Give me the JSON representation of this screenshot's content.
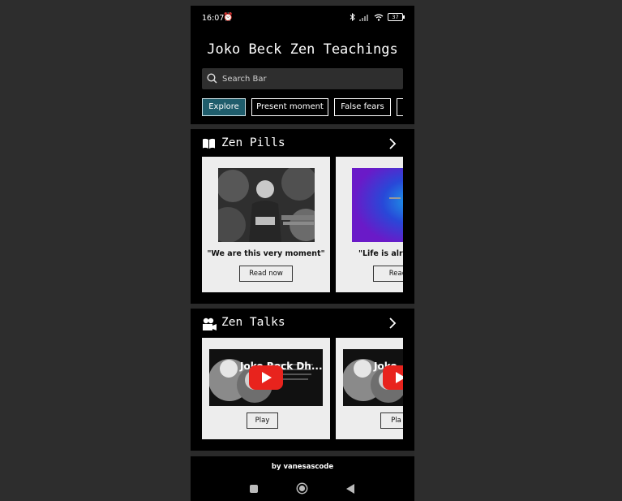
{
  "status_bar": {
    "time": "16:07",
    "battery": "37",
    "icons": [
      "alarm-icon",
      "bluetooth-icon",
      "signal-icon",
      "wifi-icon",
      "battery-icon"
    ]
  },
  "header": {
    "title": "Joko Beck Zen Teachings",
    "search_placeholder": "Search Bar",
    "chips": [
      "Explore",
      "Present moment",
      "False fears",
      ""
    ],
    "active_chip": "Explore",
    "accent_color": "#1f5d6c"
  },
  "zen_pills": {
    "title": "Zen Pills",
    "icon": "book-icon",
    "cards": [
      {
        "quote": "\"We are this very moment\"",
        "button": "Read now"
      },
      {
        "quote": "\"Life is alrea",
        "button": "Read i"
      }
    ]
  },
  "zen_talks": {
    "title": "Zen Talks",
    "icon": "video-camera-icon",
    "cards": [
      {
        "video_title": "Joko Beck Dh...",
        "button": "Play"
      },
      {
        "video_title": "Joko",
        "button": "Pla"
      }
    ]
  },
  "footer": {
    "credit": "by vanesascode"
  },
  "nav": [
    "recents-icon",
    "home-icon",
    "back-icon"
  ],
  "colors": {
    "background": "#2d2d2d",
    "panel": "#000000",
    "card": "#ededed",
    "play": "#e8231d"
  }
}
